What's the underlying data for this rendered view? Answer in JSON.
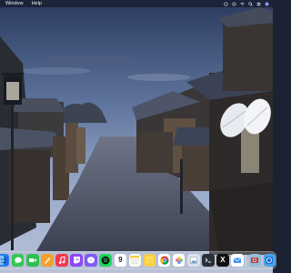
{
  "menubar": {
    "items": [
      "Window",
      "Help"
    ],
    "status_icons": [
      "menu-extra-icon",
      "menu-extra-icon",
      "wifi-icon",
      "search-icon",
      "control-center-icon",
      "siri-icon"
    ]
  },
  "wallpaper": {
    "description_icon": "kyoto-street-wallpaper"
  },
  "dock": {
    "apps": [
      {
        "name": "finder-icon",
        "color": "#2f7ff0"
      },
      {
        "name": "messages-icon",
        "color": "#35c659"
      },
      {
        "name": "facetime-icon",
        "color": "#2fbf51"
      },
      {
        "name": "pages-icon",
        "color": "#f2a12b"
      },
      {
        "name": "music-icon",
        "color": "#f3374f"
      },
      {
        "name": "twitch-icon",
        "color": "#8f45f7"
      },
      {
        "name": "messenger-icon",
        "color": "#7d5cf5"
      },
      {
        "name": "spotify-icon",
        "color": "#1ed760"
      },
      {
        "name": "calendar-icon",
        "color": "#ffffff",
        "label": "9"
      },
      {
        "name": "notes-icon",
        "color": "#fbfbf6"
      },
      {
        "name": "stickies-icon",
        "color": "#f7d04c"
      },
      {
        "name": "chrome-icon",
        "color": "#ffffff"
      },
      {
        "name": "photos-icon",
        "color": "#ffffff"
      },
      {
        "name": "preview-icon",
        "color": "#d9e3ef"
      },
      {
        "name": "terminal-icon",
        "color": "#2b2f36"
      },
      {
        "name": "x-icon",
        "color": "#111111",
        "label": "X"
      },
      {
        "name": "mail-icon",
        "color": "#ffffff"
      },
      {
        "name": "photo-booth-icon",
        "color": "#8fbfd9"
      },
      {
        "name": "trash-icon",
        "color": "#4aa3e8"
      }
    ]
  }
}
